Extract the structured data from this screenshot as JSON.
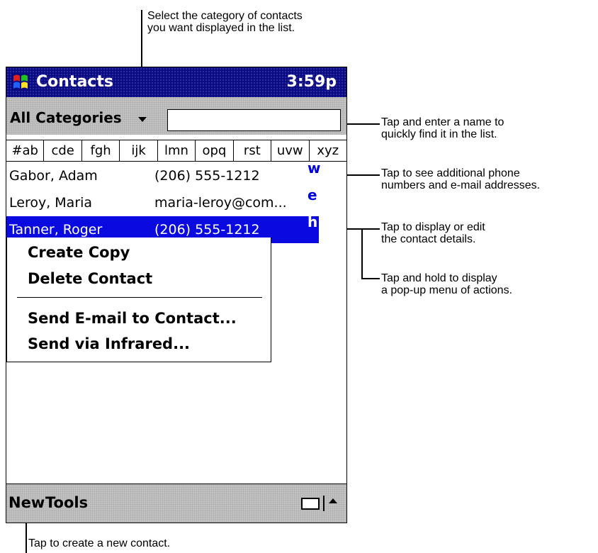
{
  "callouts": {
    "category": "Select the category of contacts\nyou want displayed in the list.",
    "find": "Tap and enter a name to\nquickly find it in the list.",
    "phone": "Tap to see additional phone\nnumbers and e-mail addresses.",
    "details": "Tap to display or edit\nthe contact details.",
    "popup": "Tap and hold to display\na pop-up menu of actions.",
    "new": "Tap to create a new contact."
  },
  "app": {
    "title": "Contacts",
    "time": "3:59p",
    "start_icon": "windows-flag-icon"
  },
  "category": {
    "label": "All Categories",
    "find_value": ""
  },
  "tabs": [
    "#ab",
    "cde",
    "fgh",
    "ijk",
    "lmn",
    "opq",
    "rst",
    "uvw",
    "xyz"
  ],
  "contacts": [
    {
      "name": "Gabor, Adam",
      "detail": "(206) 555-1212",
      "type": "w"
    },
    {
      "name": "Leroy, Maria",
      "detail": "maria-leroy@com...",
      "type": "e"
    },
    {
      "name": "Tanner, Roger",
      "detail": "(206) 555-1212",
      "type": "h"
    }
  ],
  "menu": {
    "items": [
      "Create Copy",
      "Delete Contact",
      "Send E-mail to Contact...",
      "Send via Infrared..."
    ]
  },
  "command_bar": {
    "new": "New",
    "tools": "Tools",
    "keyboard_icon": "keyboard-icon",
    "arrow_icon": "up-arrow-icon"
  },
  "colors": {
    "title_bar": "#0a0a80",
    "selection": "#0a0ae0",
    "type_letter": "#0000e0",
    "bar_gray": "#c8c8c8"
  }
}
